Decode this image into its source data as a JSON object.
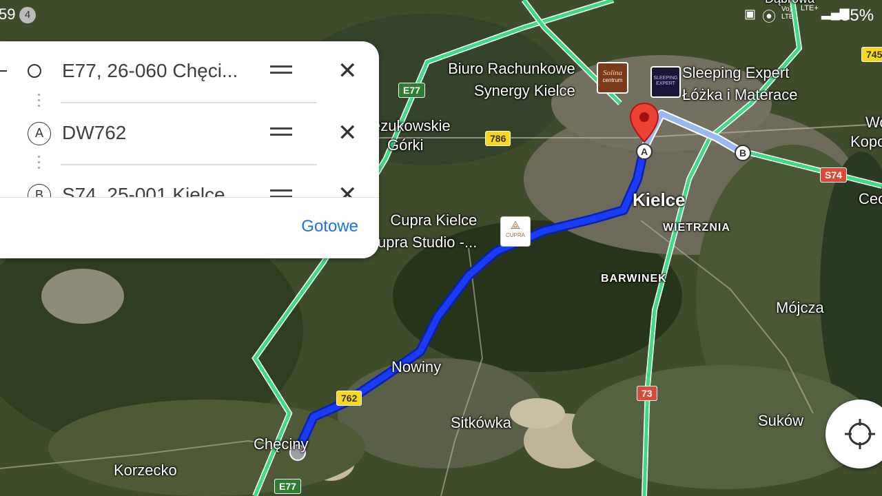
{
  "status_bar": {
    "time_fragment": "59",
    "notification_count": "4",
    "network_label": "Vo) LTE",
    "network_label2": "LTE+",
    "battery": "55%"
  },
  "route_panel": {
    "stops": [
      {
        "icon": "origin-circle-icon",
        "text": "E77, 26-060 Chęci..."
      },
      {
        "icon": "A",
        "text": "DW762"
      },
      {
        "icon": "B",
        "text": "S74, 25-001 Kielce"
      }
    ],
    "done_label": "Gotowe"
  },
  "map": {
    "places": {
      "kielce": "Kielce",
      "wietrznia": "WIETRZNIA",
      "barwinek": "BARWINEK",
      "mojcza": "Mójcza",
      "sukow": "Suków",
      "nowiny": "Nowiny",
      "sitkowka": "Sitkówka",
      "checiny": "Chęciny",
      "korzecko": "Korzecko",
      "zukowskie": "ezukowskie",
      "gorki": "Górki",
      "wo": "Wo",
      "kopo": "Kopo",
      "cec": "Cec",
      "dabrowa": "Dąbrowa"
    },
    "pois": {
      "biuro_line1": "Biuro Rachunkowe",
      "biuro_line2": "Synergy Kielce",
      "biuro_icon_text": "Solina",
      "biuro_icon_sub": "centrum",
      "sleeping_line1": "Sleeping Expert",
      "sleeping_line2": "Łóżka i Materace",
      "sleeping_icon_text": "SLEEPING EXPERT",
      "cupra_line1": "Cupra Kielce",
      "cupra_line2": "upra Studio -...",
      "cupra_icon_text": "CUPRA"
    },
    "shields": {
      "e77_top": "E77",
      "e77_bottom": "E77",
      "r786": "786",
      "r762": "762",
      "s74": "S74",
      "r73": "73",
      "r745": "745"
    },
    "markers": {
      "a": "A",
      "b": "B"
    },
    "colors": {
      "route": "#1a3cf5",
      "route_alt": "#9ab8f0",
      "highway": "#3ddc84",
      "pin": "#ea4335"
    }
  }
}
